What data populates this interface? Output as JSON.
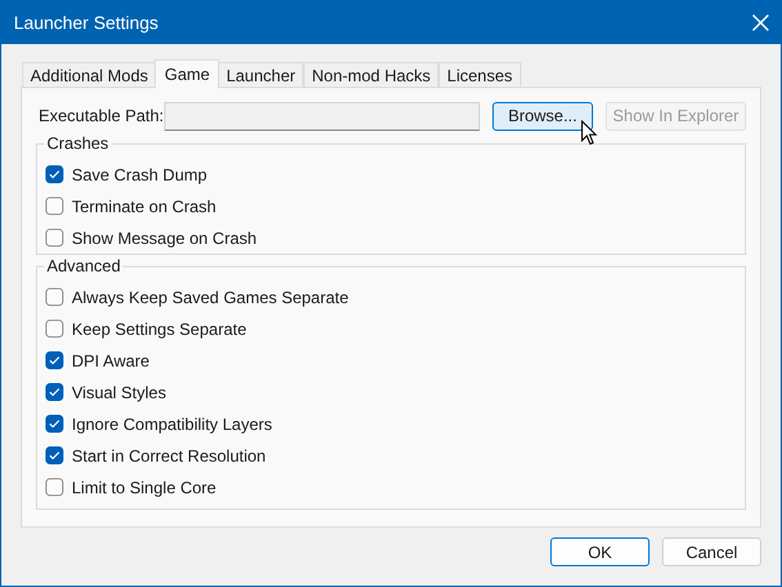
{
  "window": {
    "title": "Launcher Settings"
  },
  "tabs": [
    {
      "label": "Additional Mods",
      "selected": false
    },
    {
      "label": "Game",
      "selected": true
    },
    {
      "label": "Launcher",
      "selected": false
    },
    {
      "label": "Non-mod Hacks",
      "selected": false
    },
    {
      "label": "Licenses",
      "selected": false
    }
  ],
  "executable_path": {
    "label": "Executable Path:",
    "browse_button": {
      "label": "Browse...",
      "hovered": true
    },
    "explorer_button": {
      "label": "Show In Explorer",
      "disabled": true
    }
  },
  "groups": [
    {
      "title": "Crashes",
      "options": [
        {
          "label": "Save Crash Dump",
          "checked": true
        },
        {
          "label": "Terminate on Crash",
          "checked": false
        },
        {
          "label": "Show Message on Crash",
          "checked": false
        }
      ]
    },
    {
      "title": "Advanced",
      "options": [
        {
          "label": "Always Keep Saved Games Separate",
          "checked": false
        },
        {
          "label": "Keep Settings Separate",
          "checked": false
        },
        {
          "label": "DPI Aware",
          "checked": true
        },
        {
          "label": "Visual Styles",
          "checked": true
        },
        {
          "label": "Ignore Compatibility Layers",
          "checked": true
        },
        {
          "label": "Start in Correct Resolution",
          "checked": true
        },
        {
          "label": "Limit to Single Core",
          "checked": false
        }
      ]
    }
  ],
  "buttons": [
    {
      "label": "OK",
      "default": true
    },
    {
      "label": "Cancel",
      "default": false
    }
  ]
}
